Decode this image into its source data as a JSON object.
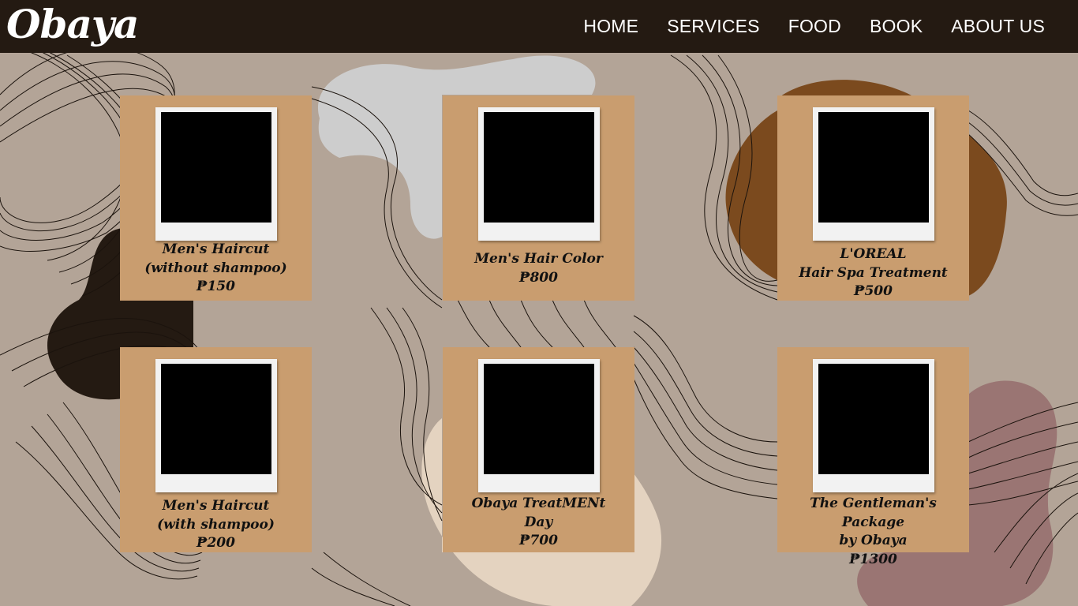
{
  "brand": {
    "logo_text": "Obaya"
  },
  "nav": {
    "items": [
      "HOME",
      "SERVICES",
      "FOOD",
      "BOOK",
      "ABOUT US"
    ]
  },
  "services": [
    {
      "lines": [
        "Men's Haircut",
        "(without shampoo)"
      ],
      "price": "₱150"
    },
    {
      "lines": [
        "Men's Hair Color"
      ],
      "price": "₱800"
    },
    {
      "lines": [
        "L'OREAL",
        "Hair Spa Treatment"
      ],
      "price": "₱500"
    },
    {
      "lines": [
        "Men's Haircut",
        "(with shampoo)"
      ],
      "price": "₱200"
    },
    {
      "lines": [
        "Obaya TreatMENt",
        "Day"
      ],
      "price": "₱700"
    },
    {
      "lines": [
        "The Gentleman's Package",
        "by Obaya"
      ],
      "price": "₱1300"
    }
  ],
  "colors": {
    "background": "#b3a497",
    "navbar": "#241a12",
    "card": "#c99d6f",
    "photo_placeholder": "#000000",
    "blob_dark": "#241a12",
    "blob_light_gray": "#cdcdcd",
    "blob_brown": "#7b4a1e",
    "blob_cream": "#e4d3c0",
    "blob_mauve": "#9a7573"
  }
}
